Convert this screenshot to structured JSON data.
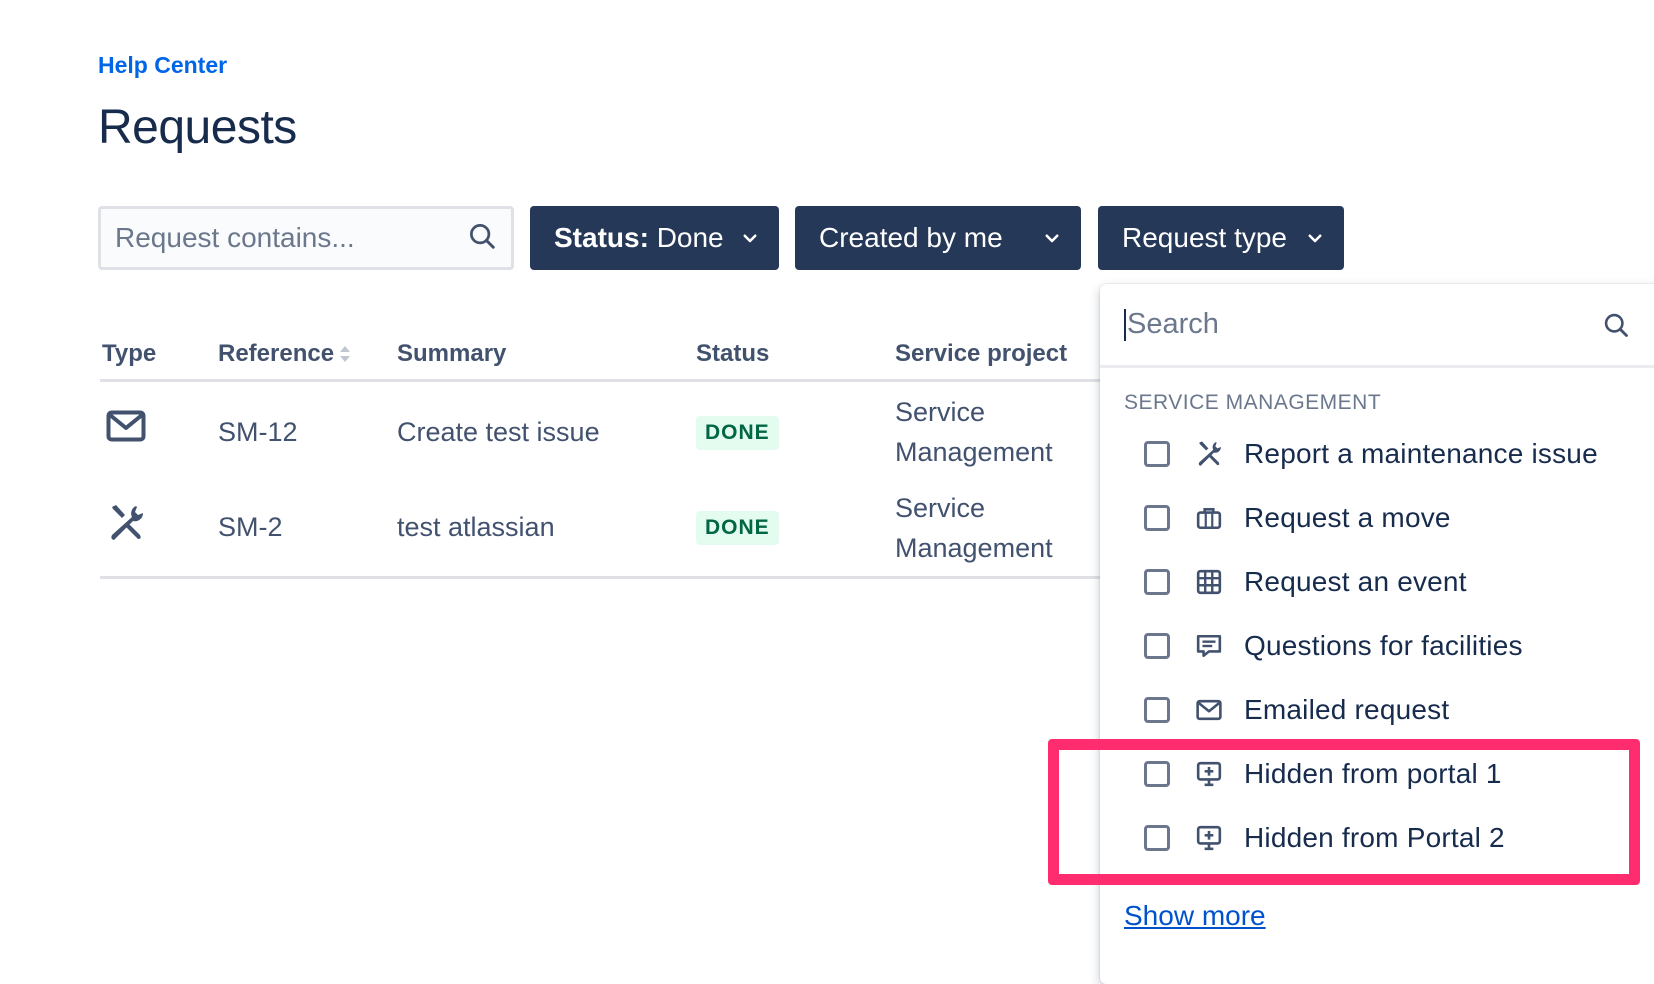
{
  "header": {
    "breadcrumb": "Help Center",
    "title": "Requests"
  },
  "filters": {
    "search_placeholder": "Request contains...",
    "status": {
      "label": "Status:",
      "value": "Done"
    },
    "created_by": "Created by me",
    "request_type": "Request type"
  },
  "table": {
    "headers": {
      "type": "Type",
      "reference": "Reference",
      "summary": "Summary",
      "status": "Status",
      "project": "Service project"
    },
    "rows": [
      {
        "type_icon": "envelope-icon",
        "reference": "SM-12",
        "summary": "Create test issue",
        "status": "DONE",
        "project": "Service Management"
      },
      {
        "type_icon": "tools-icon",
        "reference": "SM-2",
        "summary": "test atlassian",
        "status": "DONE",
        "project": "Service Management"
      }
    ]
  },
  "dropdown": {
    "search_placeholder": "Search",
    "group": "SERVICE MANAGEMENT",
    "options": [
      {
        "icon": "tools-icon",
        "label": "Report a maintenance issue"
      },
      {
        "icon": "briefcase-icon",
        "label": "Request a move"
      },
      {
        "icon": "grid-icon",
        "label": "Request an event"
      },
      {
        "icon": "chat-icon",
        "label": "Questions for facilities"
      },
      {
        "icon": "envelope-icon",
        "label": "Emailed request"
      },
      {
        "icon": "monitor-plus-icon",
        "label": "Hidden from portal 1"
      },
      {
        "icon": "monitor-plus-icon",
        "label": "Hidden from Portal 2"
      }
    ],
    "show_more": "Show more"
  },
  "colors": {
    "primary_text": "#172b4d",
    "button_bg": "#253858",
    "link": "#0052cc",
    "done_badge_bg": "#e3fcef",
    "done_badge_text": "#006644",
    "highlight": "#ff2d6f"
  }
}
